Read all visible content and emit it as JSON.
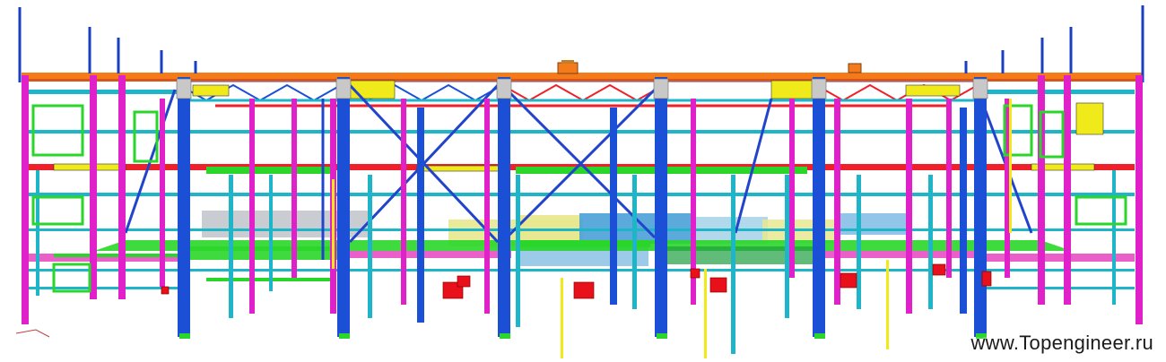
{
  "image": {
    "subject": "3d-steel-frame-model",
    "watermark": "www.Topengineer.ru"
  },
  "palette": {
    "column_magenta": "#e020c8",
    "column_blue": "#1a4fd6",
    "beam_cyan": "#1fb5c9",
    "beam_green": "#29d629",
    "beam_red": "#f0202a",
    "beam_orange": "#f57a1a",
    "beam_yellow": "#f0ea1a",
    "brace_blue": "#2244cc",
    "slab_yellow": "#e8e890",
    "slab_blue": "#4aa0d8",
    "slab_grey": "#bfc3c8",
    "equipment_red": "#e8101a"
  }
}
